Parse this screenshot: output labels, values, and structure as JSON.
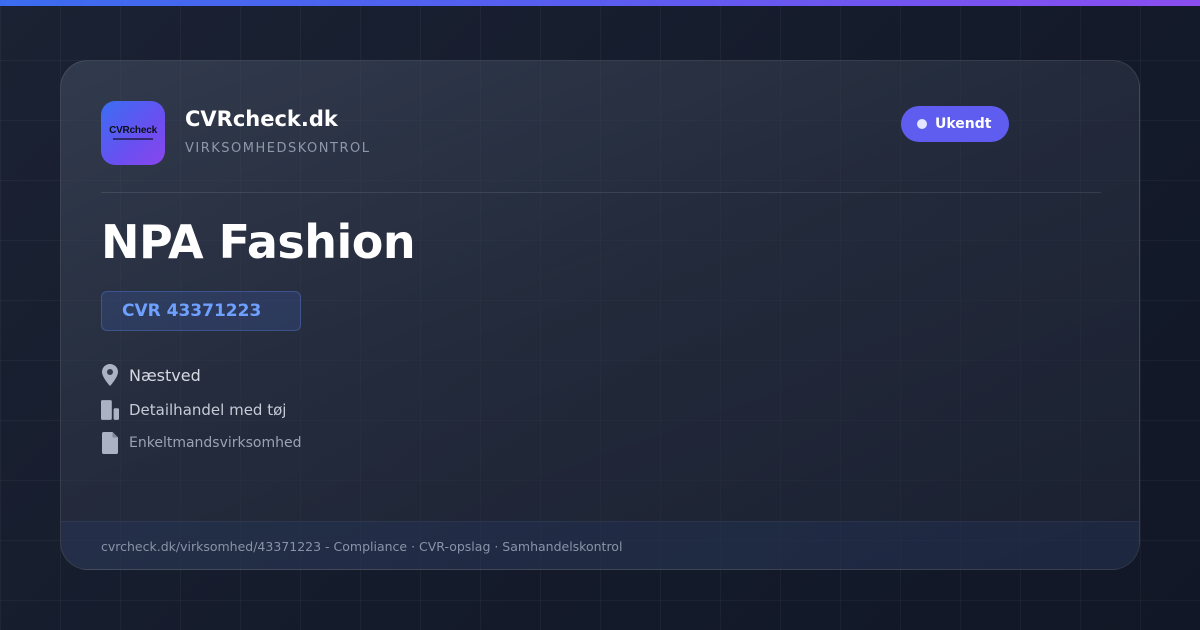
{
  "brand": {
    "logo_text": "CVRcheck",
    "name": "CVRcheck.dk",
    "subtitle": "VIRKSOMHEDSKONTROL"
  },
  "status": {
    "label": "Ukendt",
    "color": "#5f5df0"
  },
  "company": {
    "name": "NPA Fashion",
    "cvr": "CVR 43371223",
    "details": [
      {
        "icon": "location-pin-icon",
        "text": "Næstved"
      },
      {
        "icon": "building-icon",
        "text": "Detailhandel med tøj"
      },
      {
        "icon": "document-icon",
        "text": "Enkeltmandsvirksomhed"
      }
    ]
  },
  "footer": {
    "text": "cvrcheck.dk/virksomhed/43371223 - Compliance · CVR-opslag · Samhandelskontrol"
  },
  "colors": {
    "accent_gradient_start": "#3b6cf0",
    "accent_gradient_end": "#8b4df0",
    "cvr_text": "#6ea0ff"
  }
}
